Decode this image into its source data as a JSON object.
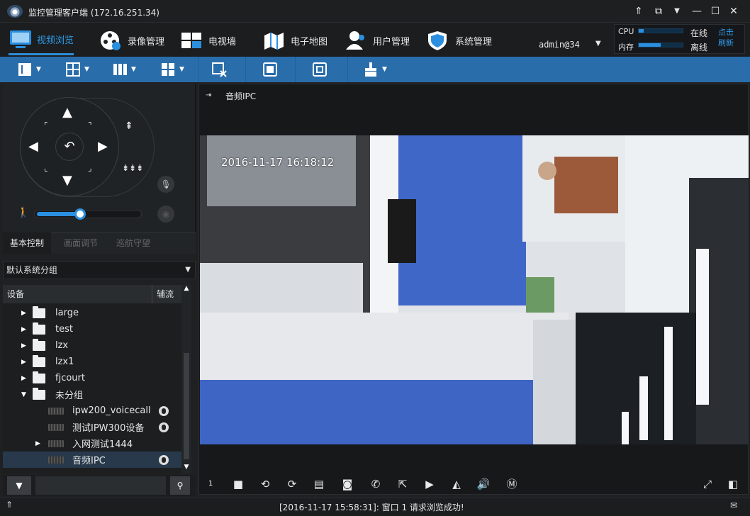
{
  "window": {
    "title": "监控管理客户端  (172.16.251.34)"
  },
  "menu": {
    "video": "视频浏览",
    "record": "录像管理",
    "tvwall": "电视墙",
    "map": "电子地图",
    "user": "用户管理",
    "system": "系统管理"
  },
  "user": {
    "name": "admin@34"
  },
  "perf": {
    "cpu_label": "CPU",
    "mem_label": "内存",
    "cpu_level": 0.12,
    "mem_level": 0.5,
    "online": "在线",
    "offline": "离线",
    "refresh": "点击刷新"
  },
  "ptz": {
    "tabs": [
      "基本控制",
      "画面调节",
      "巡航守望"
    ],
    "speed_level": 0.4
  },
  "group": {
    "selected": "默认系统分组"
  },
  "tree": {
    "col_device": "设备",
    "col_stream": "辅流",
    "items": [
      {
        "type": "folder",
        "label": "large",
        "expand": "▶"
      },
      {
        "type": "folder",
        "label": "test",
        "expand": "▶"
      },
      {
        "type": "folder",
        "label": "lzx",
        "expand": "▶"
      },
      {
        "type": "folder",
        "label": "lzx1",
        "expand": "▶"
      },
      {
        "type": "folder",
        "label": "fjcourt",
        "expand": "▶"
      },
      {
        "type": "folder",
        "label": "未分组",
        "expand": "▼"
      },
      {
        "type": "device",
        "label": "ipw200_voicecall"
      },
      {
        "type": "device",
        "label": "测试IPW300设备"
      },
      {
        "type": "device",
        "label": "入网测试1444",
        "expand": "▶"
      },
      {
        "type": "device",
        "label": "音频IPC",
        "selected": true
      }
    ]
  },
  "viewer": {
    "channel": "音频IPC",
    "osd_time": "2016-11-17  16:18:12",
    "window_no": "1"
  },
  "status": {
    "message": "[2016-11-17 15:58:31]: 窗口 1 请求浏览成功!"
  }
}
